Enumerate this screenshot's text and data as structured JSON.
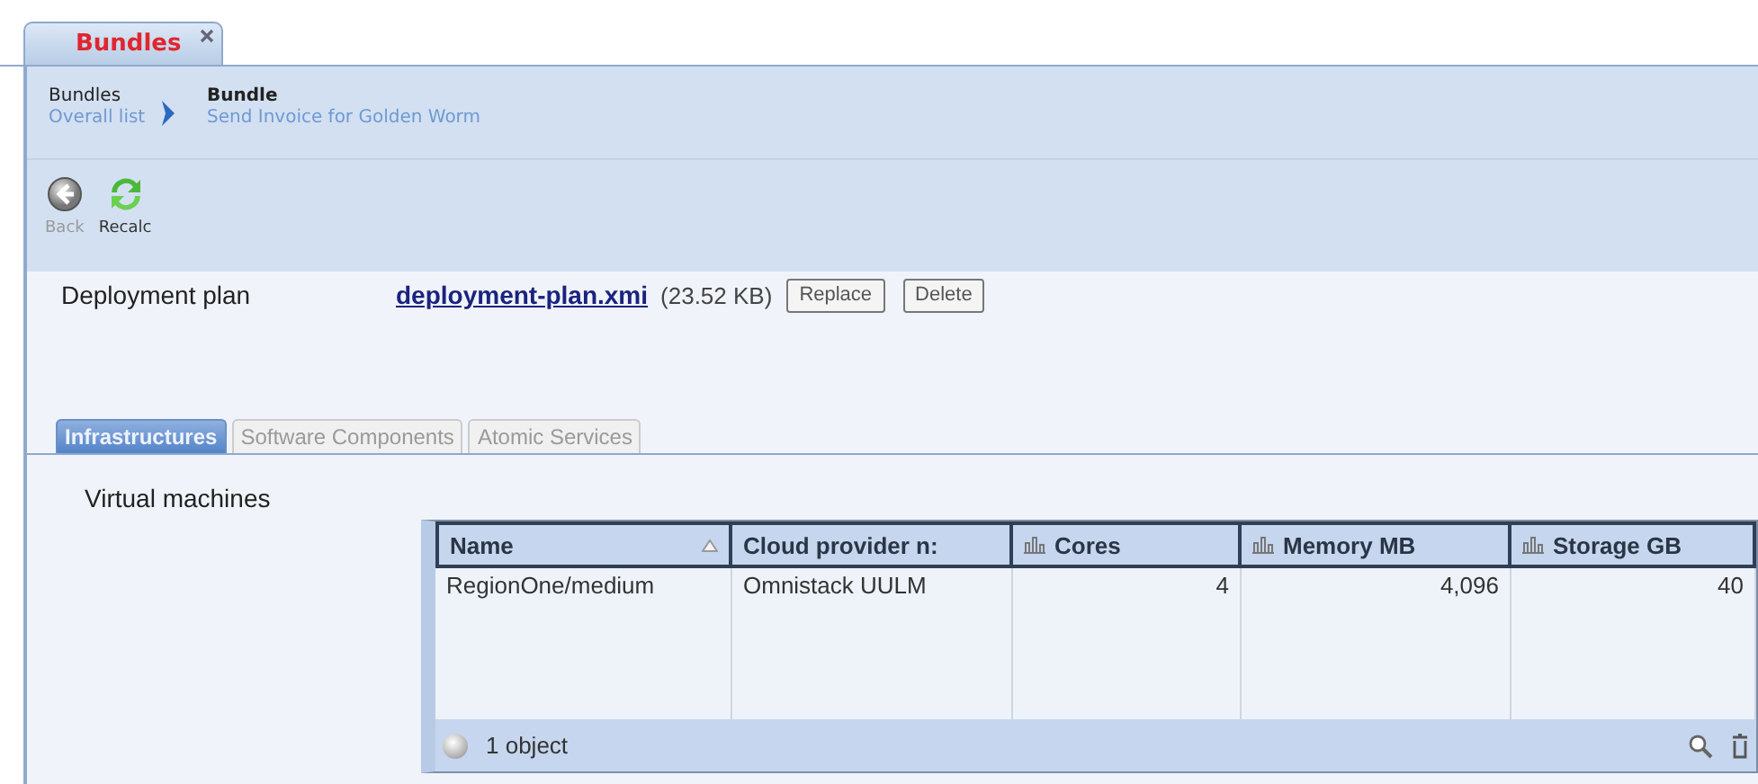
{
  "doc_tabs": [
    {
      "label": "Bundles",
      "selected": true,
      "closable": true
    }
  ],
  "breadcrumb": [
    {
      "title": "Bundles",
      "subtitle": "Overall list"
    },
    {
      "title": "Bundle",
      "subtitle": "Send Invoice for Golden Worm"
    }
  ],
  "toolbar": [
    {
      "kind": "back",
      "label": "Back",
      "disabled": true
    },
    {
      "kind": "recalc",
      "label": "Recalc",
      "disabled": false
    }
  ],
  "deployment_plan": {
    "label": "Deployment plan",
    "file": "deployment-plan.xmi",
    "size": "(23.52 KB)",
    "buttons": [
      "Replace",
      "Delete"
    ]
  },
  "tabs": [
    {
      "label": "Infrastructures",
      "selected": true
    },
    {
      "label": "Software Components",
      "selected": false
    },
    {
      "label": "Atomic Services",
      "selected": false
    }
  ],
  "section_label": "Virtual machines",
  "table": {
    "columns": [
      {
        "label": "Name",
        "kind": "text",
        "sorted": true
      },
      {
        "label": "Cloud provider n:",
        "kind": "text",
        "sorted": false
      },
      {
        "label": "Cores",
        "kind": "number",
        "sorted": false
      },
      {
        "label": "Memory MB",
        "kind": "number",
        "sorted": false
      },
      {
        "label": "Storage GB",
        "kind": "number",
        "sorted": false
      }
    ],
    "rows": [
      [
        "RegionOne/medium",
        "Omnistack UULM",
        "4",
        "4,096",
        "40"
      ]
    ],
    "footer": "1 object"
  }
}
